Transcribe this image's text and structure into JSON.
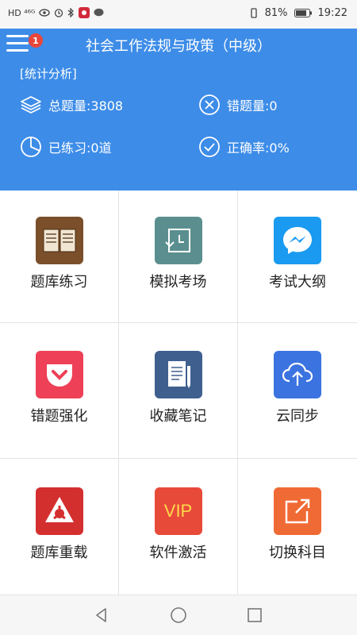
{
  "status_bar": {
    "left_indicators": "HD ⁴⁶ᴳ",
    "battery": "81%",
    "time": "19:22"
  },
  "header": {
    "title": "社会工作法规与政策（中级）",
    "badge": "1",
    "stats_label": "[统计分析]",
    "stats": {
      "total": "总题量:3808",
      "wrong": "错题量:0",
      "practiced": "已练习:0道",
      "accuracy": "正确率:0%"
    }
  },
  "grid": {
    "items": [
      {
        "label": "题库练习",
        "icon": "book-icon",
        "color": "#7a4f2a"
      },
      {
        "label": "模拟考场",
        "icon": "clock-history-icon",
        "color": "#5b8f8f"
      },
      {
        "label": "考试大纲",
        "icon": "messenger-icon",
        "color": "#1a9af0"
      },
      {
        "label": "错题强化",
        "icon": "pocket-icon",
        "color": "#ee4056"
      },
      {
        "label": "收藏笔记",
        "icon": "note-icon",
        "color": "#3f5f8f"
      },
      {
        "label": "云同步",
        "icon": "cloud-upload-icon",
        "color": "#3b73e0"
      },
      {
        "label": "题库重载",
        "icon": "reload-icon",
        "color": "#d42f2f"
      },
      {
        "label": "软件激活",
        "icon": "vip-icon",
        "color": "#e84a3a",
        "text": "VIP"
      },
      {
        "label": "切换科目",
        "icon": "switch-icon",
        "color": "#f06a35"
      }
    ]
  },
  "colors": {
    "header": "#3d8ce8",
    "badge": "#e8463a"
  }
}
